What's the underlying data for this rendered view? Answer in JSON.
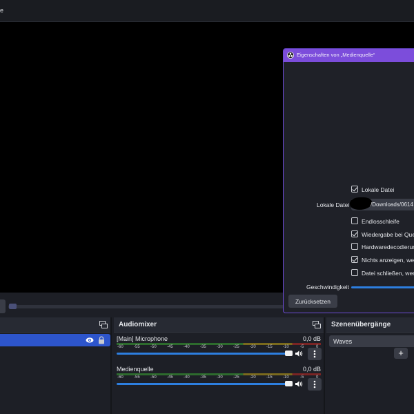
{
  "menubar": {
    "partial_item": "e"
  },
  "docks": {
    "sources": {
      "icons": [
        "eye-icon",
        "lock-icon"
      ]
    },
    "mixer": {
      "title": "Audiomixer",
      "channels": [
        {
          "name": "[Main] Microphone",
          "db": "0,0 dB"
        },
        {
          "name": "Medienquelle",
          "db": "0,0 dB"
        }
      ],
      "scale": [
        "-60",
        "-55",
        "-50",
        "-45",
        "-40",
        "-35",
        "-30",
        "-25",
        "-20",
        "-15",
        "-10",
        "-5",
        "0"
      ]
    },
    "transitions": {
      "title": "Szenenübergänge",
      "selected": "Waves",
      "add_label": "+"
    }
  },
  "dialog": {
    "title": "Eigenschaften von „Medienquelle“",
    "local_file_checkbox": "Lokale Datei",
    "local_file_label": "Lokale Datei",
    "path": "/Downloads/0614",
    "options": [
      {
        "label": "Endlosschleife",
        "checked": false
      },
      {
        "label": "Wiedergabe bei Quel",
        "checked": true
      },
      {
        "label": "Hardwaredecodierun",
        "checked": false
      },
      {
        "label": "Nichts anzeigen, wen",
        "checked": true
      },
      {
        "label": "Datei schließen, wen",
        "checked": false
      }
    ],
    "speed_label": "Geschwindigkeit",
    "reset_label": "Zurücksetzen"
  },
  "colors": {
    "accent": "#7c4ddb",
    "selection": "#2d55cc",
    "slider": "#2d7fe0"
  }
}
